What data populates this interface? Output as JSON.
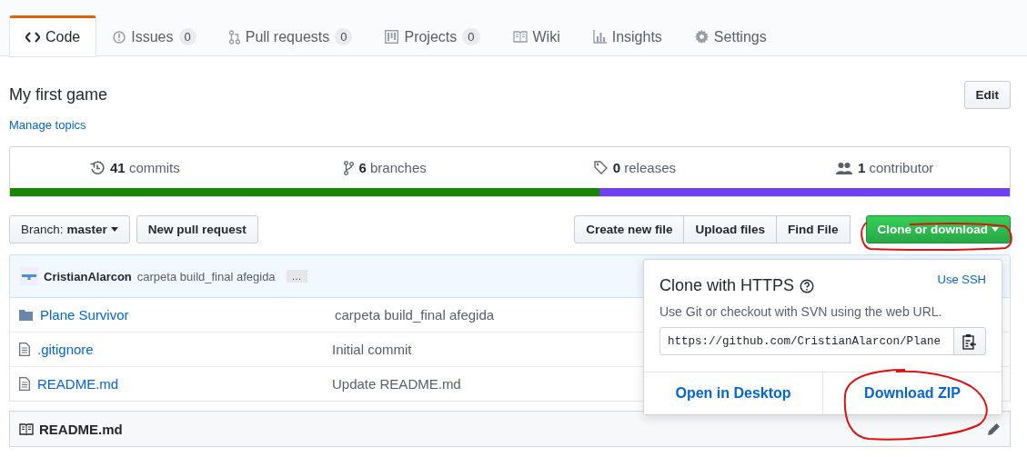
{
  "tabs": [
    {
      "label": "Code",
      "selected": true
    },
    {
      "label": "Issues",
      "count": "0",
      "selected": false
    },
    {
      "label": "Pull requests",
      "count": "0",
      "selected": false
    },
    {
      "label": "Projects",
      "count": "0",
      "selected": false
    },
    {
      "label": "Wiki",
      "selected": false
    },
    {
      "label": "Insights",
      "selected": false
    },
    {
      "label": "Settings",
      "selected": false
    }
  ],
  "repo": {
    "description": "My first game",
    "topics_link": "Manage topics",
    "edit_button": "Edit"
  },
  "stats": [
    {
      "count": "41",
      "label": "commits"
    },
    {
      "count": "6",
      "label": "branches"
    },
    {
      "count": "0",
      "label": "releases"
    },
    {
      "count": "1",
      "label": "contributor"
    }
  ],
  "language_bar": [
    {
      "color": "#178600",
      "level": 0.59
    },
    {
      "color": "#6e40f4",
      "level": 0.41
    }
  ],
  "toolbar": {
    "branch_label": "Branch:",
    "branch": "master",
    "new_pr": "New pull request",
    "file_buttons": [
      "Create new file",
      "Upload files",
      "Find File"
    ],
    "clone_button": "Clone or download"
  },
  "commit": {
    "author": "CristianAlarcon",
    "message": "carpeta build_final afegida",
    "ellipsis": "…"
  },
  "files": [
    {
      "kind": "folder",
      "name": "Plane Survivor",
      "message": "carpeta build_final afegida"
    },
    {
      "kind": "file",
      "name": ".gitignore",
      "message": "Initial commit"
    },
    {
      "kind": "file",
      "name": "README.md",
      "message": "Update README.md"
    }
  ],
  "readme": {
    "title": "README.md"
  },
  "clone_popover": {
    "title": "Clone with HTTPS",
    "switch_link": "Use SSH",
    "hint": "Use Git or checkout with SVN using the web URL.",
    "url": "https://github.com/CristianAlarcon/Plane",
    "actions": [
      "Open in Desktop",
      "Download ZIP"
    ]
  }
}
